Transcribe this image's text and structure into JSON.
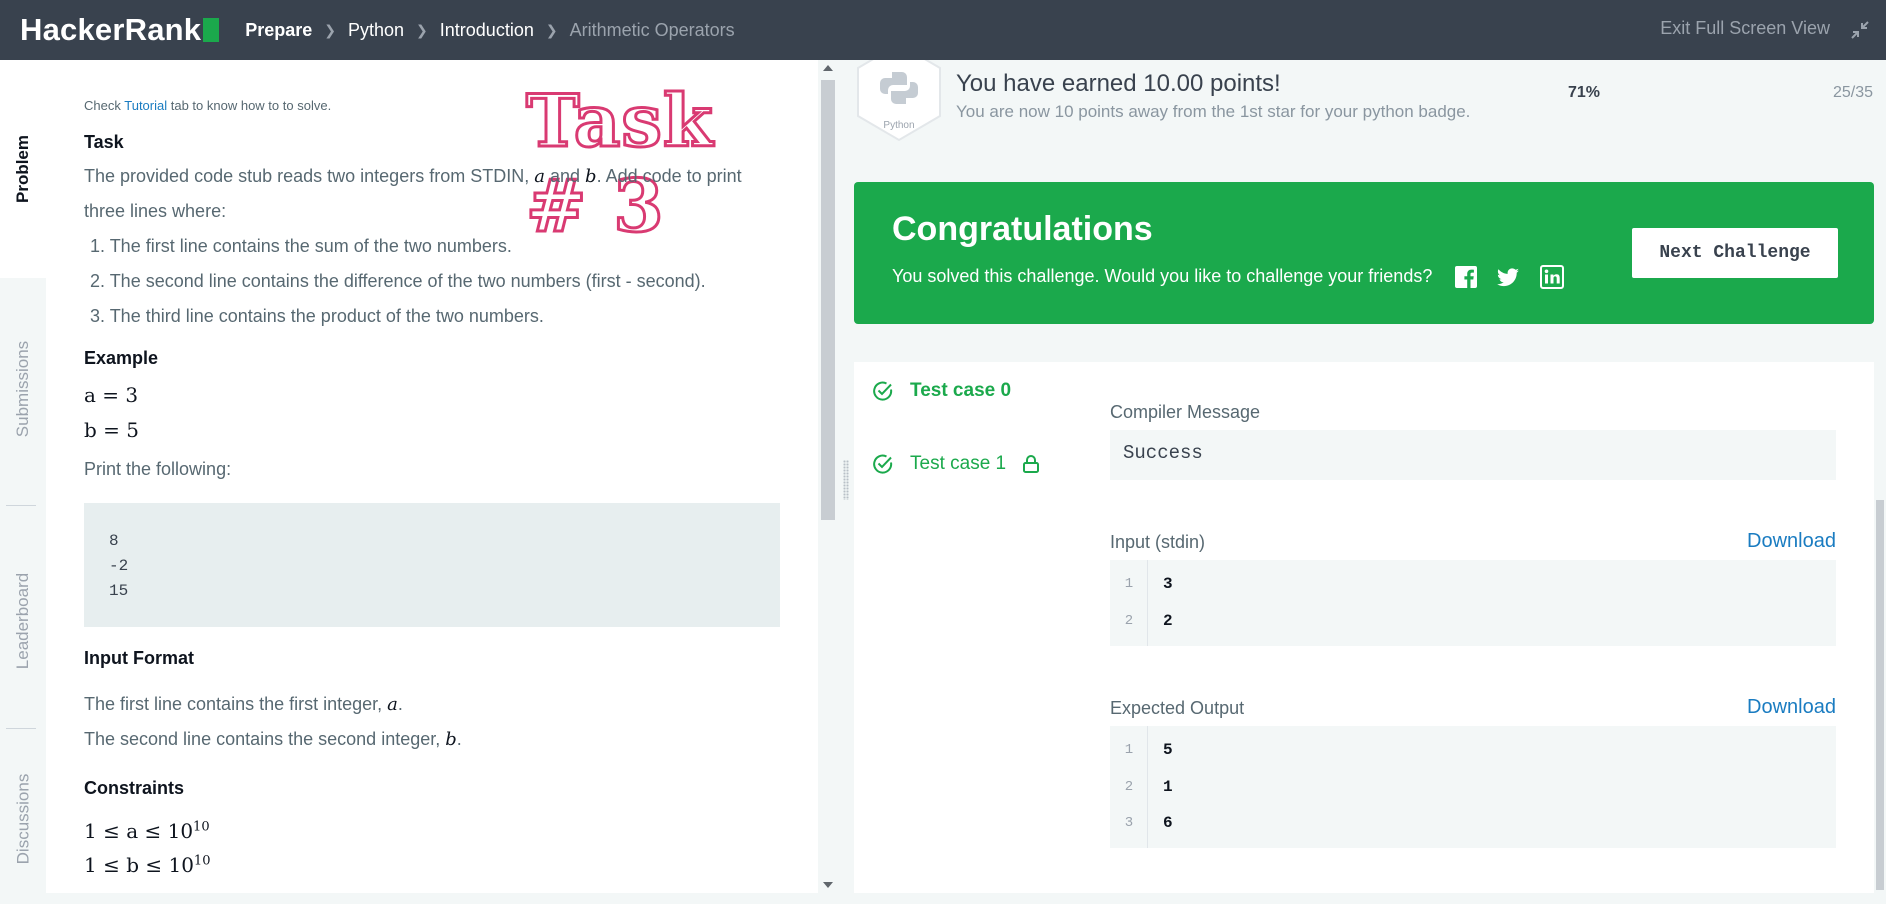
{
  "topbar": {
    "logo": "HackerRank",
    "breadcrumbs": [
      "Prepare",
      "Python",
      "Introduction",
      "Arithmetic Operators"
    ],
    "exit_label": "Exit Full Screen View"
  },
  "side_tabs": [
    "Problem",
    "Submissions",
    "Leaderboard",
    "Discussions"
  ],
  "problem": {
    "hint_prefix": "Check",
    "hint_link": "Tutorial",
    "hint_suffix": "tab to know how to to solve.",
    "overlay_text": "Task # 3",
    "task_heading": "Task",
    "task_line1_a": "The provided code stub reads two integers from STDIN,",
    "task_var_a": "a",
    "task_and": "and",
    "task_var_b": "b",
    "task_line1_b": ". Add code to print",
    "task_line2": "three lines where:",
    "list": [
      "1. The first line contains the sum of the two numbers.",
      "2. The second line contains the difference of the two numbers (first - second).",
      "3. The third line contains the product of the two numbers."
    ],
    "example_heading": "Example",
    "example_a": "a = 3",
    "example_b": "b = 5",
    "print_following": "Print the following:",
    "code_lines": [
      "8",
      "-2",
      "15"
    ],
    "input_heading": "Input Format",
    "input_line1": "The first line contains the first integer,",
    "input_line2": "The second line contains the second integer,",
    "input_var_a": "a",
    "input_var_b": "b",
    "period": ".",
    "constraints_heading": "Constraints",
    "constraint_a": "1 ≤ a ≤ 10",
    "constraint_b": "1 ≤ b ≤ 10",
    "exp": "10"
  },
  "points": {
    "badge_label": "Python",
    "title": "You have earned 10.00 points!",
    "subtitle": "You are now 10 points away from the 1st star for your python badge.",
    "percent": "71%",
    "progress": "25/35"
  },
  "congrats": {
    "title": "Congratulations",
    "subtitle": "You solved this challenge. Would you like to challenge your friends?",
    "next_button": "Next Challenge"
  },
  "results": {
    "test_cases": [
      "Test case 0",
      "Test case 1"
    ],
    "compiler_label": "Compiler Message",
    "compiler_message": "Success",
    "input_label": "Input (stdin)",
    "download": "Download",
    "input_lines": [
      {
        "n": "1",
        "v": "3"
      },
      {
        "n": "2",
        "v": "2"
      }
    ],
    "expected_label": "Expected Output",
    "expected_lines": [
      {
        "n": "1",
        "v": "5"
      },
      {
        "n": "2",
        "v": "1"
      },
      {
        "n": "3",
        "v": "6"
      }
    ]
  },
  "colors": {
    "topbar": "#39424e",
    "brand_green": "#1ba94c",
    "link_blue": "#1a7cc1",
    "overlay_pink": "#d93a72"
  }
}
